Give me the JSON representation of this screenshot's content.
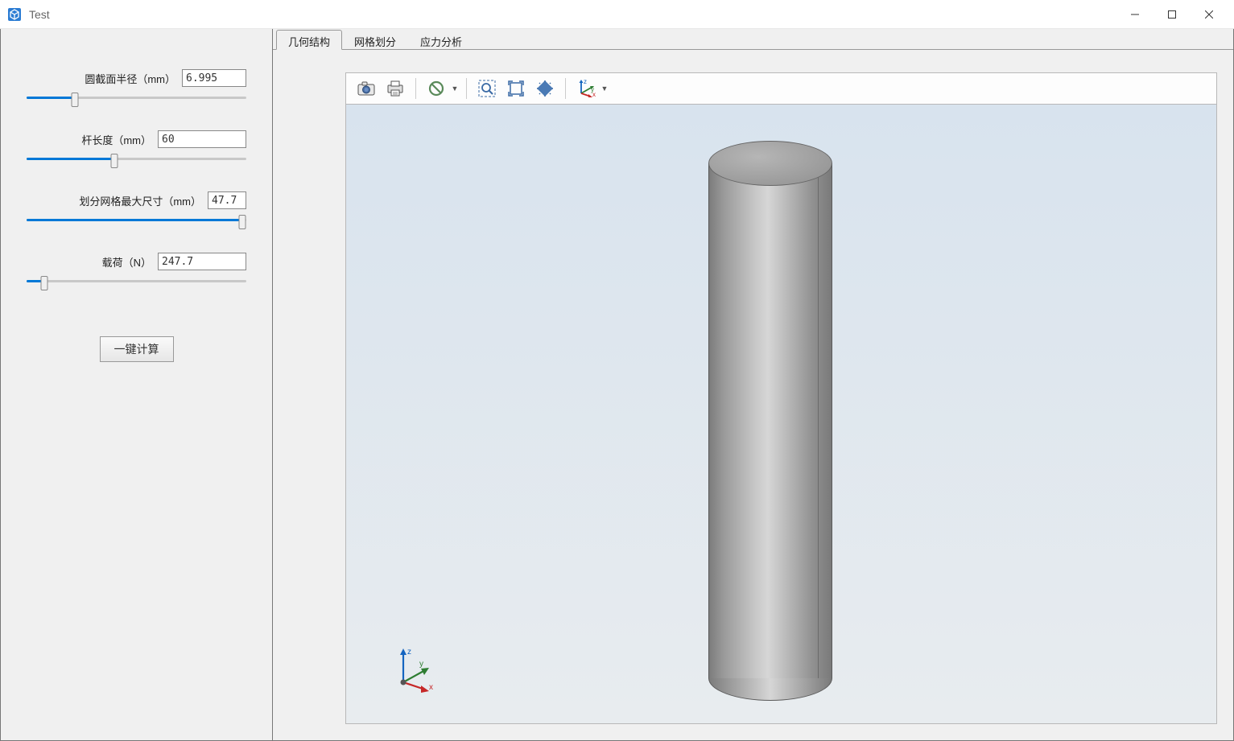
{
  "window": {
    "title": "Test"
  },
  "sidebar": {
    "params": [
      {
        "label": "圆截面半径（mm）",
        "value": "6.995",
        "slider_pct": 22,
        "input_wide": false
      },
      {
        "label": "杆长度（mm）",
        "value": "60",
        "slider_pct": 40,
        "input_wide": true
      },
      {
        "label": "划分网格最大尺寸（mm）",
        "value": "47.7",
        "slider_pct": 98,
        "input_wide": false,
        "narrow": true
      },
      {
        "label": "载荷（N）",
        "value": "247.7",
        "slider_pct": 8,
        "input_wide": true
      }
    ],
    "calc_button": "一键计算"
  },
  "tabs": [
    {
      "label": "几何结构",
      "active": true
    },
    {
      "label": "网格划分",
      "active": false
    },
    {
      "label": "应力分析",
      "active": false
    }
  ],
  "toolbar": {
    "items": [
      {
        "name": "camera-icon",
        "type": "btn"
      },
      {
        "name": "print-icon",
        "type": "btn"
      },
      {
        "type": "sep"
      },
      {
        "name": "forbid-icon",
        "type": "btn",
        "dropdown": true
      },
      {
        "type": "sep"
      },
      {
        "name": "zoom-area-icon",
        "type": "btn"
      },
      {
        "name": "fit-icon",
        "type": "btn"
      },
      {
        "name": "isoview-icon",
        "type": "btn"
      },
      {
        "type": "sep"
      },
      {
        "name": "axes-icon",
        "type": "btn",
        "dropdown": true
      }
    ]
  },
  "triad": {
    "x_label": "x",
    "y_label": "y",
    "z_label": "z"
  }
}
